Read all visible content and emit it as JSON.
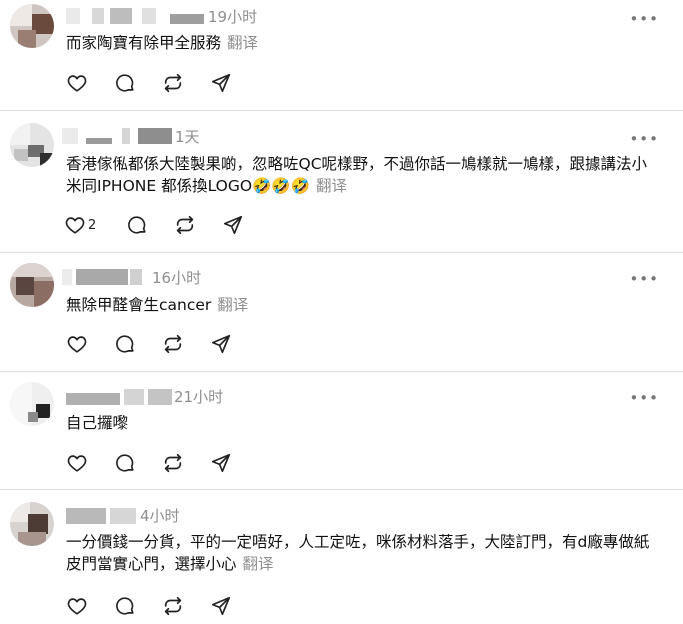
{
  "posts": [
    {
      "time": "19小时",
      "text": "而家陶寶有除甲全服務",
      "translate": "翻译",
      "likes": ""
    },
    {
      "time": "1天",
      "text": "香港傢俬都係大陸製果啲，忽略咗QC呢樣野，不過你話一鳩樣就一鳩樣，跟據講法小米同IPHONE 都係換LOGO🤣🤣🤣",
      "translate": "翻译",
      "likes": "2"
    },
    {
      "time": "16小时",
      "text": "無除甲醛會生cancer",
      "translate": "翻译",
      "likes": ""
    },
    {
      "time": "21小时",
      "text": "自己攞嚟",
      "translate": "",
      "likes": ""
    },
    {
      "time": "4小时",
      "text": "一分價錢一分貨，平的一定唔好，人工定咗，咪係材料落手，大陸訂門，有d廠專做紙皮門當實心門，選擇小心",
      "translate": "翻译",
      "likes": ""
    }
  ],
  "icons": {
    "more": "more-horizontal-icon",
    "like": "heart-icon",
    "reply": "comment-icon",
    "repost": "repost-icon",
    "share": "send-icon"
  },
  "more_label": "•••"
}
